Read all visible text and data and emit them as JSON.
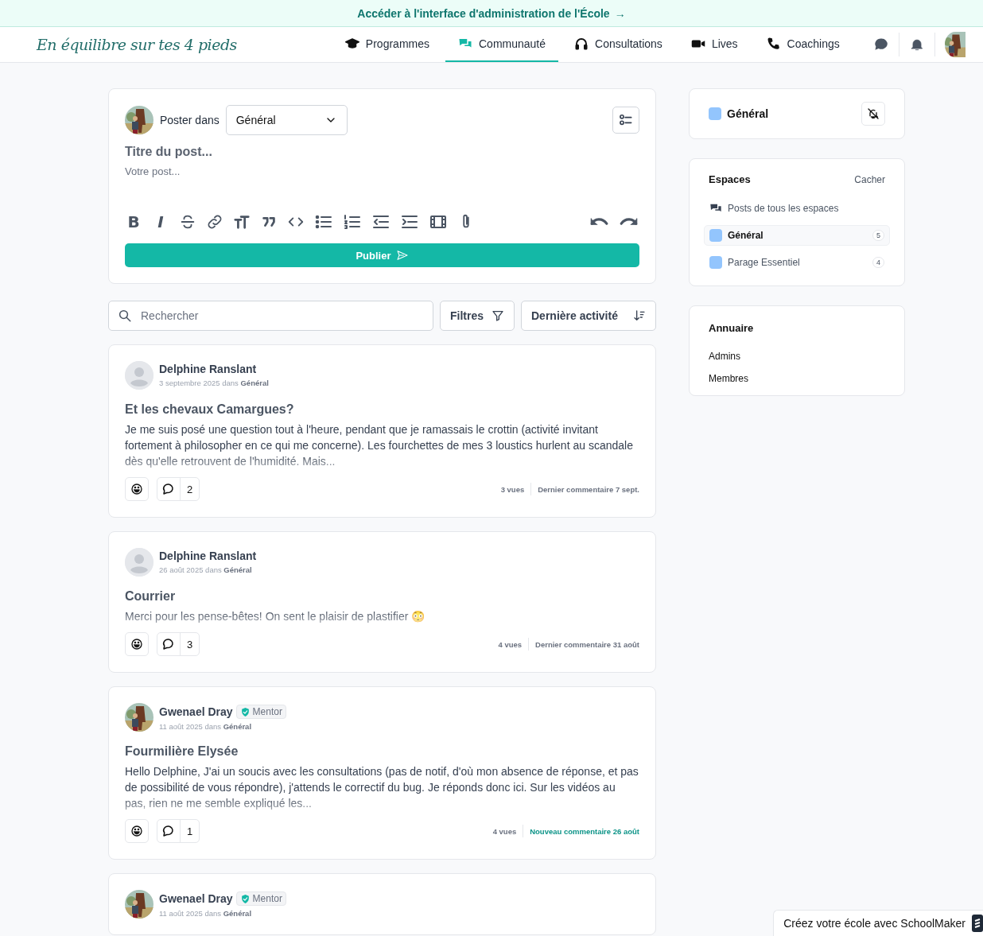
{
  "admin_banner": {
    "text": "Accéder à l'interface d'administration de l'École",
    "arrow": "→"
  },
  "header": {
    "brand": "En équilibre sur tes 4 pieds",
    "nav": [
      {
        "label": "Programmes",
        "selected": false
      },
      {
        "label": "Communauté",
        "selected": true
      },
      {
        "label": "Consultations",
        "selected": false
      },
      {
        "label": "Lives",
        "selected": false
      },
      {
        "label": "Coachings",
        "selected": false
      }
    ]
  },
  "composer": {
    "prefix": "Poster dans",
    "space": "Général",
    "title_placeholder": "Titre du post...",
    "body_placeholder": "Votre post...",
    "toolbar": [
      {
        "kind": "bold",
        "glyph": "B"
      },
      {
        "kind": "italic",
        "glyph": "I"
      },
      {
        "kind": "strike"
      },
      {
        "kind": "link"
      },
      {
        "kind": "heading"
      },
      {
        "kind": "quote"
      },
      {
        "kind": "code"
      },
      {
        "kind": "bullets"
      },
      {
        "kind": "numbers"
      },
      {
        "kind": "outdent"
      },
      {
        "kind": "indent"
      },
      {
        "kind": "video"
      },
      {
        "kind": "attach"
      },
      {
        "kind": "undo"
      },
      {
        "kind": "redo"
      }
    ],
    "submit": "Publier"
  },
  "feed_controls": {
    "search_placeholder": "Rechercher",
    "filter": "Filtres",
    "sort": "Dernière activité"
  },
  "posts": [
    {
      "author": "Delphine Ranslant",
      "avatar": {
        "kind": "placeholder"
      },
      "meta": "3 septembre 2025 dans **Général**",
      "title": "Et les chevaux Camargues?",
      "excerpt": "Je me suis posé une question tout à l'heure, pendant que je ramassais le crottin (activité invitant fortement à philosopher en ce qui me concerne).  Les fourchettes de mes 3 loustics hurlent au scandale dès qu'elle retrouvent de l'humidité. Mais...",
      "comments": "2",
      "views": "3 vues",
      "activity": "Dernier commentaire 7 sept.",
      "new_activity": false
    },
    {
      "author": "Delphine Ranslant",
      "avatar": {
        "kind": "placeholder"
      },
      "meta": "26 août 2025 dans **Général**",
      "title": "Courrier",
      "excerpt": "Merci pour les pense-bêtes! On sent le plaisir de plastifier 😳",
      "comments": "3",
      "views": "4 vues",
      "activity": "Dernier commentaire 31 août",
      "new_activity": false
    },
    {
      "author": "Gwenael Dray",
      "badge": "Mentor",
      "meta": "11 août 2025 dans **Général**",
      "title": "Fourmilière Elysée",
      "excerpt": "Hello Delphine,  J'ai un soucis avec les consultations (pas de notif, d'où mon absence de réponse, et pas de possibilité de vous répondre), j'attends le correctif du bug. Je réponds donc ici. Sur les vidéos au pas, rien ne me semble expliqué les...",
      "comments": "1",
      "views": "4 vues",
      "activity": "Nouveau commentaire 26 août",
      "new_activity": true
    },
    {
      "author": "Gwenael Dray",
      "badge": "Mentor",
      "meta": "11 août 2025 dans **Général**"
    }
  ],
  "sidebar": {
    "current_space": {
      "name": "Général",
      "color": "#93c5fd"
    },
    "spaces": {
      "title": "Espaces",
      "toggle": "Cacher",
      "all": "Posts de tous les espaces",
      "items": [
        {
          "name": "Général",
          "count": "5",
          "color": "#93c5fd",
          "selected": true
        },
        {
          "name": "Parage Essentiel",
          "count": "4",
          "color": "#93c5fd",
          "selected": false
        }
      ]
    },
    "directory": {
      "title": "Annuaire",
      "links": [
        "Admins",
        "Membres"
      ]
    }
  },
  "promo": {
    "text": "Créez votre école avec SchoolMaker"
  }
}
